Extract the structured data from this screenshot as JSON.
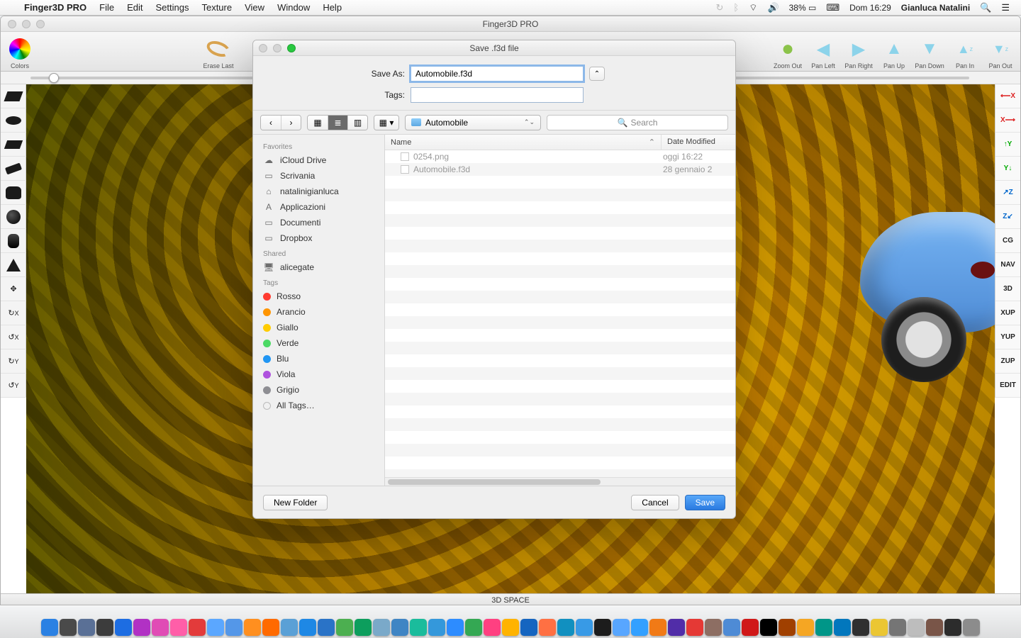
{
  "menubar": {
    "app": "Finger3D PRO",
    "items": [
      "File",
      "Edit",
      "Settings",
      "Texture",
      "View",
      "Window",
      "Help"
    ],
    "battery": "38%",
    "clock": "Dom 16:29",
    "user": "Gianluca Natalini"
  },
  "app_window": {
    "title": "Finger3D PRO",
    "status": "3D SPACE"
  },
  "toolbar": {
    "left": [
      {
        "name": "colors-button",
        "label": "Colors"
      },
      {
        "name": "erase-last-button",
        "label": "Erase Last"
      }
    ],
    "right": [
      {
        "name": "zoom-out-button",
        "label": "Zoom Out",
        "icon": "⬤"
      },
      {
        "name": "pan-left-button",
        "label": "Pan Left",
        "icon": "◀"
      },
      {
        "name": "pan-right-button",
        "label": "Pan Right",
        "icon": "▶"
      },
      {
        "name": "pan-up-button",
        "label": "Pan Up",
        "icon": "▲"
      },
      {
        "name": "pan-down-button",
        "label": "Pan Down",
        "icon": "▼"
      },
      {
        "name": "pan-in-button",
        "label": "Pan In",
        "icon": "◆"
      },
      {
        "name": "pan-out-button",
        "label": "Pan Out",
        "icon": "◇"
      }
    ]
  },
  "left_tools": [
    {
      "name": "shape-parallelogram"
    },
    {
      "name": "shape-ellipse-flat"
    },
    {
      "name": "shape-diamond-flat"
    },
    {
      "name": "shape-bar"
    },
    {
      "name": "shape-curved"
    },
    {
      "name": "shape-sphere"
    },
    {
      "name": "shape-cylinder"
    },
    {
      "name": "shape-cone"
    },
    {
      "name": "move-tool",
      "label": "✥"
    },
    {
      "name": "rotate-x-tool",
      "label": "X"
    },
    {
      "name": "rotate-x2-tool",
      "label": "X"
    },
    {
      "name": "rotate-y-tool",
      "label": "Y"
    },
    {
      "name": "rotate-y2-tool",
      "label": "Y"
    }
  ],
  "right_tools": [
    {
      "name": "axis-x-neg",
      "label": "⟵X",
      "color": "#d22"
    },
    {
      "name": "axis-x-pos",
      "label": "X⟶",
      "color": "#d22"
    },
    {
      "name": "axis-y-neg",
      "label": "↑Y",
      "color": "#0a0"
    },
    {
      "name": "axis-y-pos",
      "label": "Y↓",
      "color": "#0a0"
    },
    {
      "name": "axis-z-neg",
      "label": "↗Z",
      "color": "#06c"
    },
    {
      "name": "axis-z-pos",
      "label": "Z↙",
      "color": "#06c"
    },
    {
      "name": "mode-cg",
      "label": "CG"
    },
    {
      "name": "mode-nav",
      "label": "NAV"
    },
    {
      "name": "mode-3d",
      "label": "3D"
    },
    {
      "name": "mode-xup",
      "label": "XUP"
    },
    {
      "name": "mode-yup",
      "label": "YUP"
    },
    {
      "name": "mode-zup",
      "label": "ZUP"
    },
    {
      "name": "mode-edit",
      "label": "EDIT"
    }
  ],
  "dialog": {
    "title": "Save .f3d file",
    "save_as_label": "Save As:",
    "save_as_value": "Automobile.f3d",
    "tags_label": "Tags:",
    "tags_value": "",
    "folder": "Automobile",
    "search_placeholder": "Search",
    "columns": {
      "name": "Name",
      "date": "Date Modified"
    },
    "files": [
      {
        "name": "0254.png",
        "date": "oggi 16:22"
      },
      {
        "name": "Automobile.f3d",
        "date": "28 gennaio 2"
      }
    ],
    "sidebar": {
      "favorites_label": "Favorites",
      "favorites": [
        {
          "icon": "☁︎",
          "label": "iCloud Drive"
        },
        {
          "icon": "▭",
          "label": "Scrivania"
        },
        {
          "icon": "⌂",
          "label": "natalinigianluca"
        },
        {
          "icon": "A",
          "label": "Applicazioni"
        },
        {
          "icon": "▭",
          "label": "Documenti"
        },
        {
          "icon": "▭",
          "label": "Dropbox"
        }
      ],
      "shared_label": "Shared",
      "shared": [
        {
          "icon": "🖥",
          "label": "alicegate"
        }
      ],
      "tags_label": "Tags",
      "tags": [
        {
          "color": "#ff3b30",
          "label": "Rosso"
        },
        {
          "color": "#ff9500",
          "label": "Arancio"
        },
        {
          "color": "#ffcc00",
          "label": "Giallo"
        },
        {
          "color": "#4cd964",
          "label": "Verde"
        },
        {
          "color": "#2196f3",
          "label": "Blu"
        },
        {
          "color": "#af52de",
          "label": "Viola"
        },
        {
          "color": "#8e8e93",
          "label": "Grigio"
        },
        {
          "color": "",
          "label": "All Tags…"
        }
      ]
    },
    "new_folder": "New Folder",
    "cancel": "Cancel",
    "save": "Save"
  },
  "dock_icons": [
    "#2b81e3",
    "#4a4a4a",
    "#5a7096",
    "#3c3c3c",
    "#1d6de2",
    "#b131c4",
    "#e04cb5",
    "#ff5ea8",
    "#e33b3b",
    "#5ba7ff",
    "#5497e8",
    "#ff8f1f",
    "#ff6a00",
    "#5aa0d6",
    "#1e88e5",
    "#2a73c7",
    "#4caf50",
    "#0d9e5d",
    "#7aa9c9",
    "#3f85c4",
    "#1abc9c",
    "#3498db",
    "#2d8cff",
    "#34a853",
    "#ff4081",
    "#ffb300",
    "#1565c0",
    "#ff7043",
    "#1190c0",
    "#389ae6",
    "#1c1c1c",
    "#58a6ff",
    "#33a0ff",
    "#f17a16",
    "#512da8",
    "#e53935",
    "#8d6e63",
    "#4e8bd5",
    "#d01818",
    "#000000",
    "#a04000",
    "#f5a623",
    "#009688",
    "#0277bd",
    "#303030",
    "#ebc633",
    "#757575",
    "#bdbdbd",
    "#795548",
    "#2c2c2c",
    "#8c8c8c"
  ]
}
